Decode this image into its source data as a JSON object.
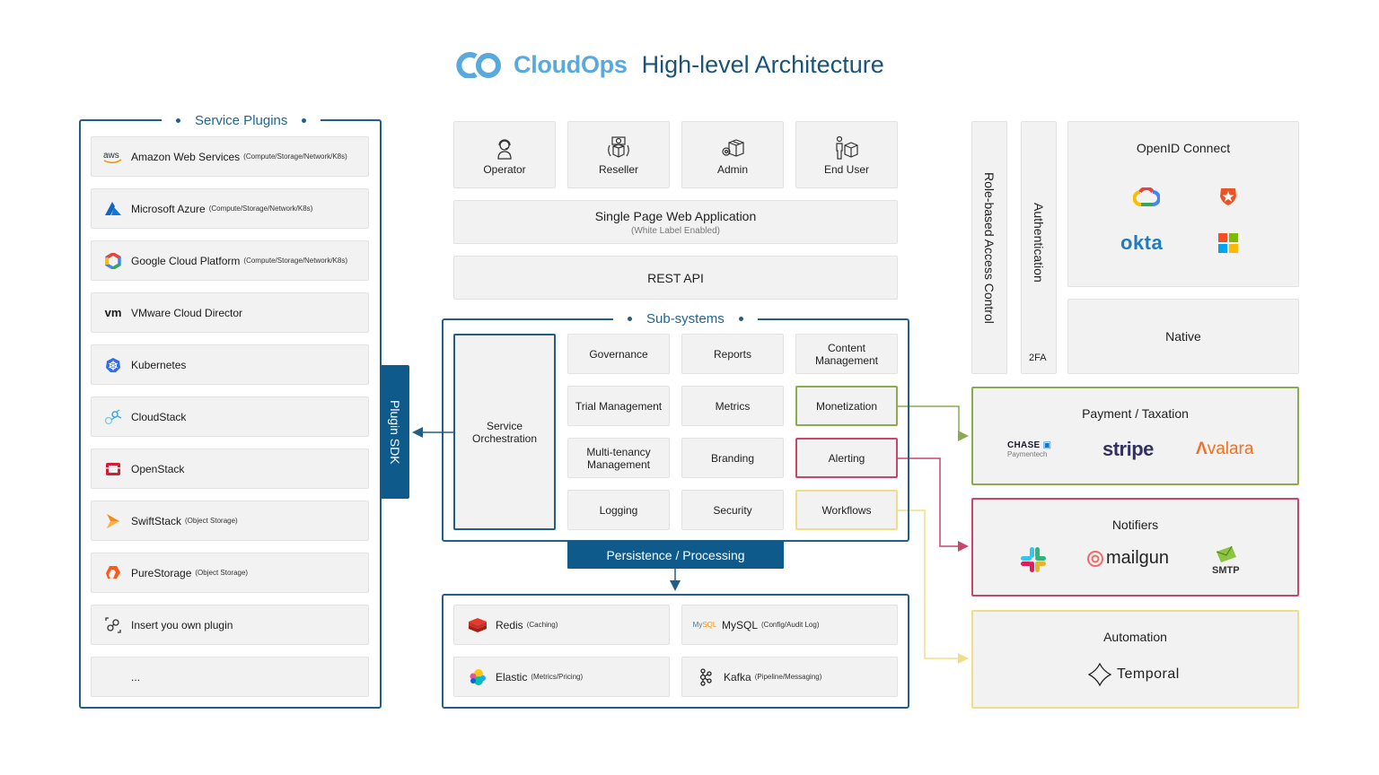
{
  "header": {
    "brand": "CloudOps",
    "title": "High-level Architecture",
    "brand_color": "#5aa9dc",
    "title_color": "#1a5479"
  },
  "service_plugins": {
    "label": "Service Plugins",
    "items": [
      {
        "name": "Amazon Web Services",
        "note": "(Compute/Storage/Network/K8s)",
        "icon": "aws-icon"
      },
      {
        "name": "Microsoft Azure",
        "note": "(Compute/Storage/Network/K8s)",
        "icon": "azure-icon"
      },
      {
        "name": "Google Cloud Platform",
        "note": "(Compute/Storage/Network/K8s)",
        "icon": "gcp-icon"
      },
      {
        "name": "VMware Cloud Director",
        "note": "",
        "icon": "vmware-icon"
      },
      {
        "name": "Kubernetes",
        "note": "",
        "icon": "kubernetes-icon"
      },
      {
        "name": "CloudStack",
        "note": "",
        "icon": "cloudstack-icon"
      },
      {
        "name": "OpenStack",
        "note": "",
        "icon": "openstack-icon"
      },
      {
        "name": "SwiftStack",
        "note": "(Object Storage)",
        "icon": "swiftstack-icon"
      },
      {
        "name": "PureStorage",
        "note": "(Object Storage)",
        "icon": "purestorage-icon"
      },
      {
        "name": "Insert you own plugin",
        "note": "",
        "icon": "plugin-icon"
      },
      {
        "name": "...",
        "note": "",
        "icon": ""
      }
    ],
    "aws_glyph": "aws",
    "vmware_glyph": "vm"
  },
  "plugin_sdk": {
    "label": "Plugin SDK"
  },
  "personas": [
    {
      "label": "Operator",
      "icon": "headset-user-icon"
    },
    {
      "label": "Reseller",
      "icon": "money-box-icon"
    },
    {
      "label": "Admin",
      "icon": "gear-box-icon"
    },
    {
      "label": "End User",
      "icon": "user-box-icon"
    }
  ],
  "spa": {
    "title": "Single Page Web Application",
    "subtitle": "(White Label Enabled)"
  },
  "rest_api": {
    "label": "REST API"
  },
  "subsystems": {
    "label": "Sub-systems",
    "orchestration": "Service Orchestration",
    "grid": [
      [
        "Governance",
        "Reports",
        "Content Management"
      ],
      [
        "Trial Management",
        "Metrics",
        "Monetization"
      ],
      [
        "Multi-tenancy Management",
        "Branding",
        "Alerting"
      ],
      [
        "Logging",
        "Security",
        "Workflows"
      ]
    ]
  },
  "persistence": {
    "label": "Persistence / Processing",
    "items": [
      {
        "name": "Redis",
        "note": "(Caching)",
        "icon": "redis-icon"
      },
      {
        "name": "MySQL",
        "note": "(Config/Audit Log)",
        "icon": "mysql-icon",
        "logo_text_a": "My",
        "logo_text_b": "SQL"
      },
      {
        "name": "Elastic",
        "note": "(Metrics/Pricing)",
        "icon": "elastic-icon"
      },
      {
        "name": "Kafka",
        "note": "(Pipeline/Messaging)",
        "icon": "kafka-icon"
      }
    ]
  },
  "auth": {
    "rbac": "Role-based Access Control",
    "authentication": "Authentication",
    "twofa": "2FA",
    "openid": {
      "title": "OpenID Connect",
      "providers": [
        "Google Cloud",
        "Auth0",
        "okta",
        "Microsoft"
      ],
      "okta_text": "okta"
    },
    "native": "Native"
  },
  "payment": {
    "title": "Payment / Taxation",
    "color": "#8aab4e",
    "chase_a": "CHASE",
    "chase_b": "Paymentech",
    "stripe": "stripe",
    "avalara": "Avalara",
    "avalara_rest": "valara"
  },
  "notifiers": {
    "title": "Notifiers",
    "color": "#c7476b",
    "mailgun": "mailgun",
    "smtp": "SMTP"
  },
  "automation": {
    "title": "Automation",
    "color": "#f0dd8c",
    "temporal": "Temporal"
  },
  "colors": {
    "frame_blue": "#215f86",
    "sdk_fill": "#0e5a8a",
    "card_bg": "#f2f2f2"
  }
}
